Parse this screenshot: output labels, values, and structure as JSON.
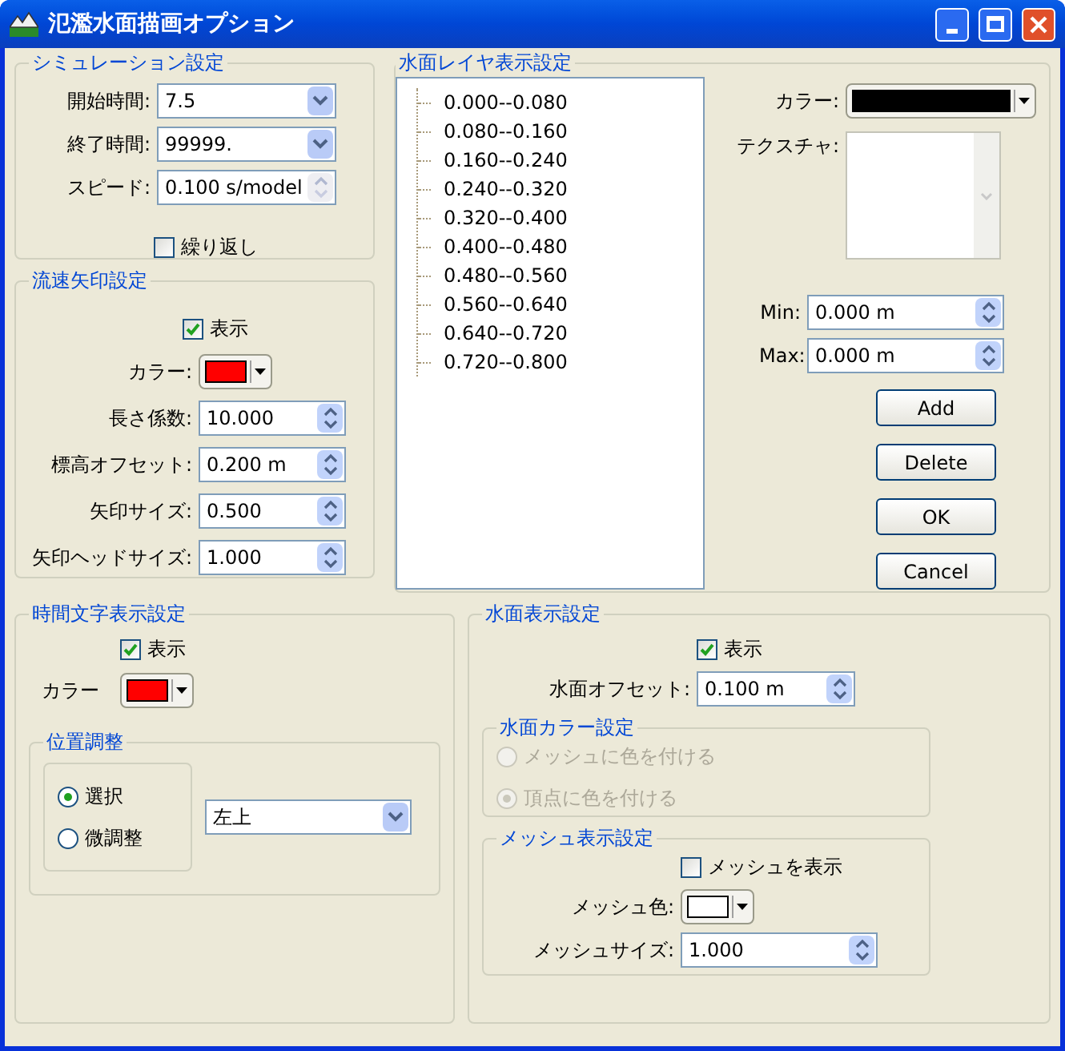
{
  "window": {
    "title": "氾濫水面描画オプション"
  },
  "simulation": {
    "title": "シミュレーション設定",
    "fields": [
      {
        "label": "開始時間:",
        "value": "7.5",
        "kind": "combo",
        "disabled": false
      },
      {
        "label": "終了時間:",
        "value": "99999.",
        "kind": "combo",
        "disabled": false
      },
      {
        "label": "スピード:",
        "value": "0.100 s/model",
        "kind": "spin",
        "disabled": true
      }
    ],
    "repeat": {
      "label": "繰り返し",
      "checked": false
    }
  },
  "arrows": {
    "title": "流速矢印設定",
    "show": {
      "label": "表示",
      "checked": true
    },
    "color": {
      "label": "カラー:",
      "color": "#ff0000"
    },
    "fields": [
      {
        "label": "長さ係数:",
        "value": "10.000"
      },
      {
        "label": "標高オフセット:",
        "value": "0.200 m"
      },
      {
        "label": "矢印サイズ:",
        "value": "0.500"
      },
      {
        "label": "矢印ヘッドサイズ:",
        "value": "1.000"
      }
    ]
  },
  "layers": {
    "title": "水面レイヤ表示設定",
    "items": [
      "0.000--0.080",
      "0.080--0.160",
      "0.160--0.240",
      "0.240--0.320",
      "0.320--0.400",
      "0.400--0.480",
      "0.480--0.560",
      "0.560--0.640",
      "0.640--0.720",
      "0.720--0.800"
    ],
    "color": {
      "label": "カラー:",
      "color": "#000000"
    },
    "texture": {
      "label": "テクスチャ:"
    },
    "min": {
      "label": "Min:",
      "value": "0.000 m"
    },
    "max": {
      "label": "Max:",
      "value": "0.000 m"
    },
    "buttons": [
      "Add",
      "Delete",
      "OK",
      "Cancel"
    ]
  },
  "time_text": {
    "title": "時間文字表示設定",
    "show": {
      "label": "表示",
      "checked": true
    },
    "color": {
      "label": "カラー",
      "color": "#ff0000"
    },
    "position": {
      "title": "位置調整",
      "options": [
        {
          "label": "選択",
          "selected": true
        },
        {
          "label": "微調整",
          "selected": false
        }
      ],
      "dropdown": {
        "value": "左上"
      }
    }
  },
  "water": {
    "title": "水面表示設定",
    "show": {
      "label": "表示",
      "checked": true
    },
    "offset": {
      "label": "水面オフセット:",
      "value": "0.100 m"
    },
    "color_settings": {
      "title": "水面カラー設定",
      "disabled": true,
      "options": [
        {
          "label": "メッシュに色を付ける",
          "selected": false
        },
        {
          "label": "頂点に色を付ける",
          "selected": true
        }
      ]
    },
    "mesh": {
      "title": "メッシュ表示設定",
      "show": {
        "label": "メッシュを表示",
        "checked": false
      },
      "color": {
        "label": "メッシュ色:",
        "color": "#ffffff"
      },
      "size": {
        "label": "メッシュサイズ:",
        "value": "1.000"
      }
    }
  }
}
